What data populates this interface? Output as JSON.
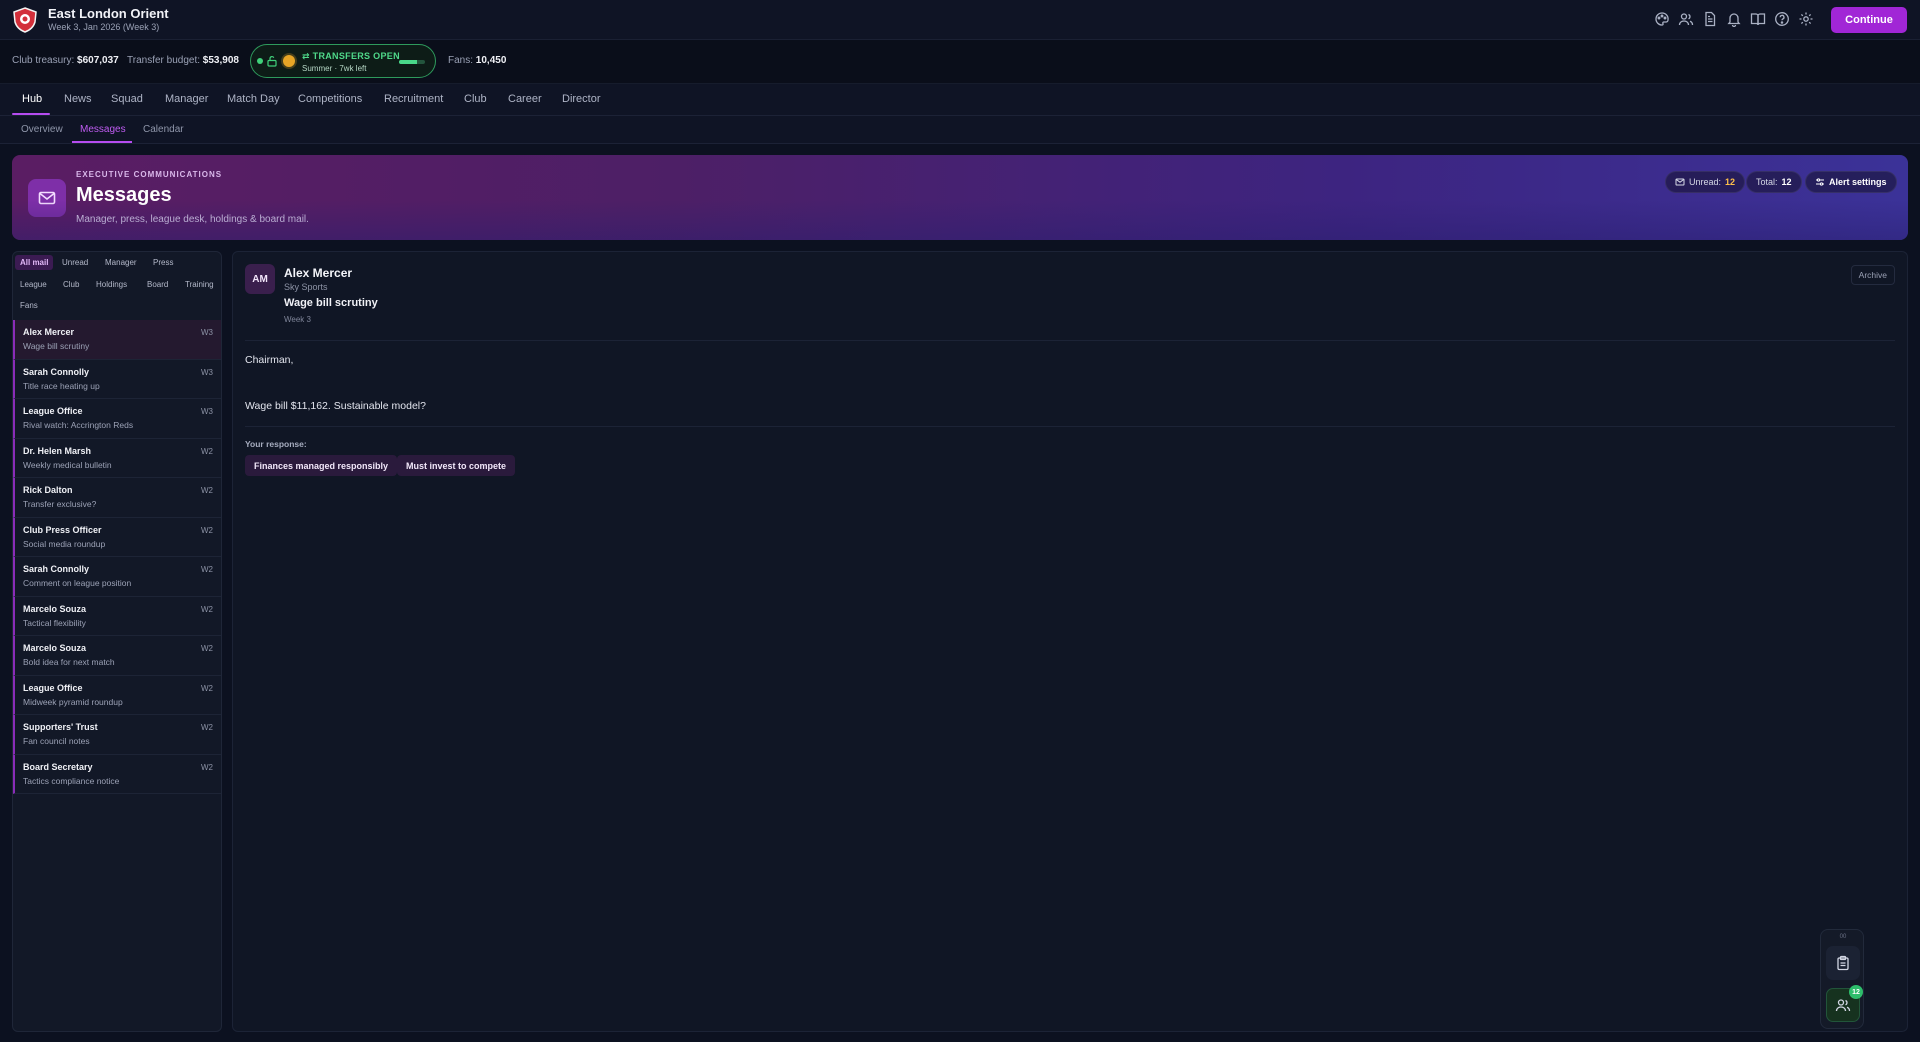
{
  "header": {
    "club_name": "East London Orient",
    "club_subtitle": "Week 3, Jan 2026 (Week 3)",
    "icons": [
      "palette-icon",
      "people-icon",
      "document-icon",
      "bell-icon",
      "book-icon",
      "help-icon",
      "gear-icon"
    ],
    "continue_label": "Continue",
    "accent_color": "#a126d6"
  },
  "status": {
    "treasury_label": "Club treasury:",
    "treasury_value": "$607,037",
    "budget_label": "Transfer budget:",
    "budget_value": "$53,908",
    "window_title": "TRANSFERS OPEN",
    "window_sub": "Summer · 7wk left",
    "window_progress": 0.7,
    "fans_label": "Fans:",
    "fans_value": "10,450"
  },
  "nav": {
    "tabs": [
      "Hub",
      "News",
      "Squad",
      "Manager",
      "Match Day",
      "Competitions",
      "Recruitment",
      "Club",
      "Career",
      "Director"
    ],
    "active_tab": "Hub",
    "subtabs": [
      "Overview",
      "Messages",
      "Calendar"
    ],
    "active_subtab": "Messages"
  },
  "banner": {
    "kicker": "EXECUTIVE COMMUNICATIONS",
    "title": "Messages",
    "subtitle": "Manager, press, league desk, holdings & board mail.",
    "unread_label": "Unread:",
    "unread_value": "12",
    "total_label": "Total:",
    "total_value": "12",
    "alert_label": "Alert settings"
  },
  "inbox": {
    "filters": [
      "All mail",
      "Unread",
      "Manager",
      "Press",
      "League",
      "Club",
      "Holdings",
      "Board",
      "Training",
      "Fans"
    ],
    "active_filter": "All mail",
    "messages": [
      {
        "from": "Alex Mercer",
        "subject": "Wage bill scrutiny",
        "week": "W3"
      },
      {
        "from": "Sarah Connolly",
        "subject": "Title race heating up",
        "week": "W3"
      },
      {
        "from": "League Office",
        "subject": "Rival watch: Accrington Reds",
        "week": "W3"
      },
      {
        "from": "Dr. Helen Marsh",
        "subject": "Weekly medical bulletin",
        "week": "W2"
      },
      {
        "from": "Rick Dalton",
        "subject": "Transfer exclusive?",
        "week": "W2"
      },
      {
        "from": "Club Press Officer",
        "subject": "Social media roundup",
        "week": "W2"
      },
      {
        "from": "Sarah Connolly",
        "subject": "Comment on league position",
        "week": "W2"
      },
      {
        "from": "Marcelo Souza",
        "subject": "Tactical flexibility",
        "week": "W2"
      },
      {
        "from": "Marcelo Souza",
        "subject": "Bold idea for next match",
        "week": "W2"
      },
      {
        "from": "League Office",
        "subject": "Midweek pyramid roundup",
        "week": "W2"
      },
      {
        "from": "Supporters' Trust",
        "subject": "Fan council notes",
        "week": "W2"
      },
      {
        "from": "Board Secretary",
        "subject": "Tactics compliance notice",
        "week": "W2"
      }
    ]
  },
  "reader": {
    "avatar_initials": "AM",
    "from": "Alex Mercer",
    "org": "Sky Sports",
    "subject": "Wage bill scrutiny",
    "week": "Week 3",
    "archive_label": "Archive",
    "greeting": "Chairman,",
    "body": "Wage bill $11,162. Sustainable model?",
    "response_label": "Your response:",
    "responses": [
      "Finances managed responsibly",
      "Must invest to compete"
    ]
  },
  "dock": {
    "label": "00",
    "badge": "12"
  }
}
